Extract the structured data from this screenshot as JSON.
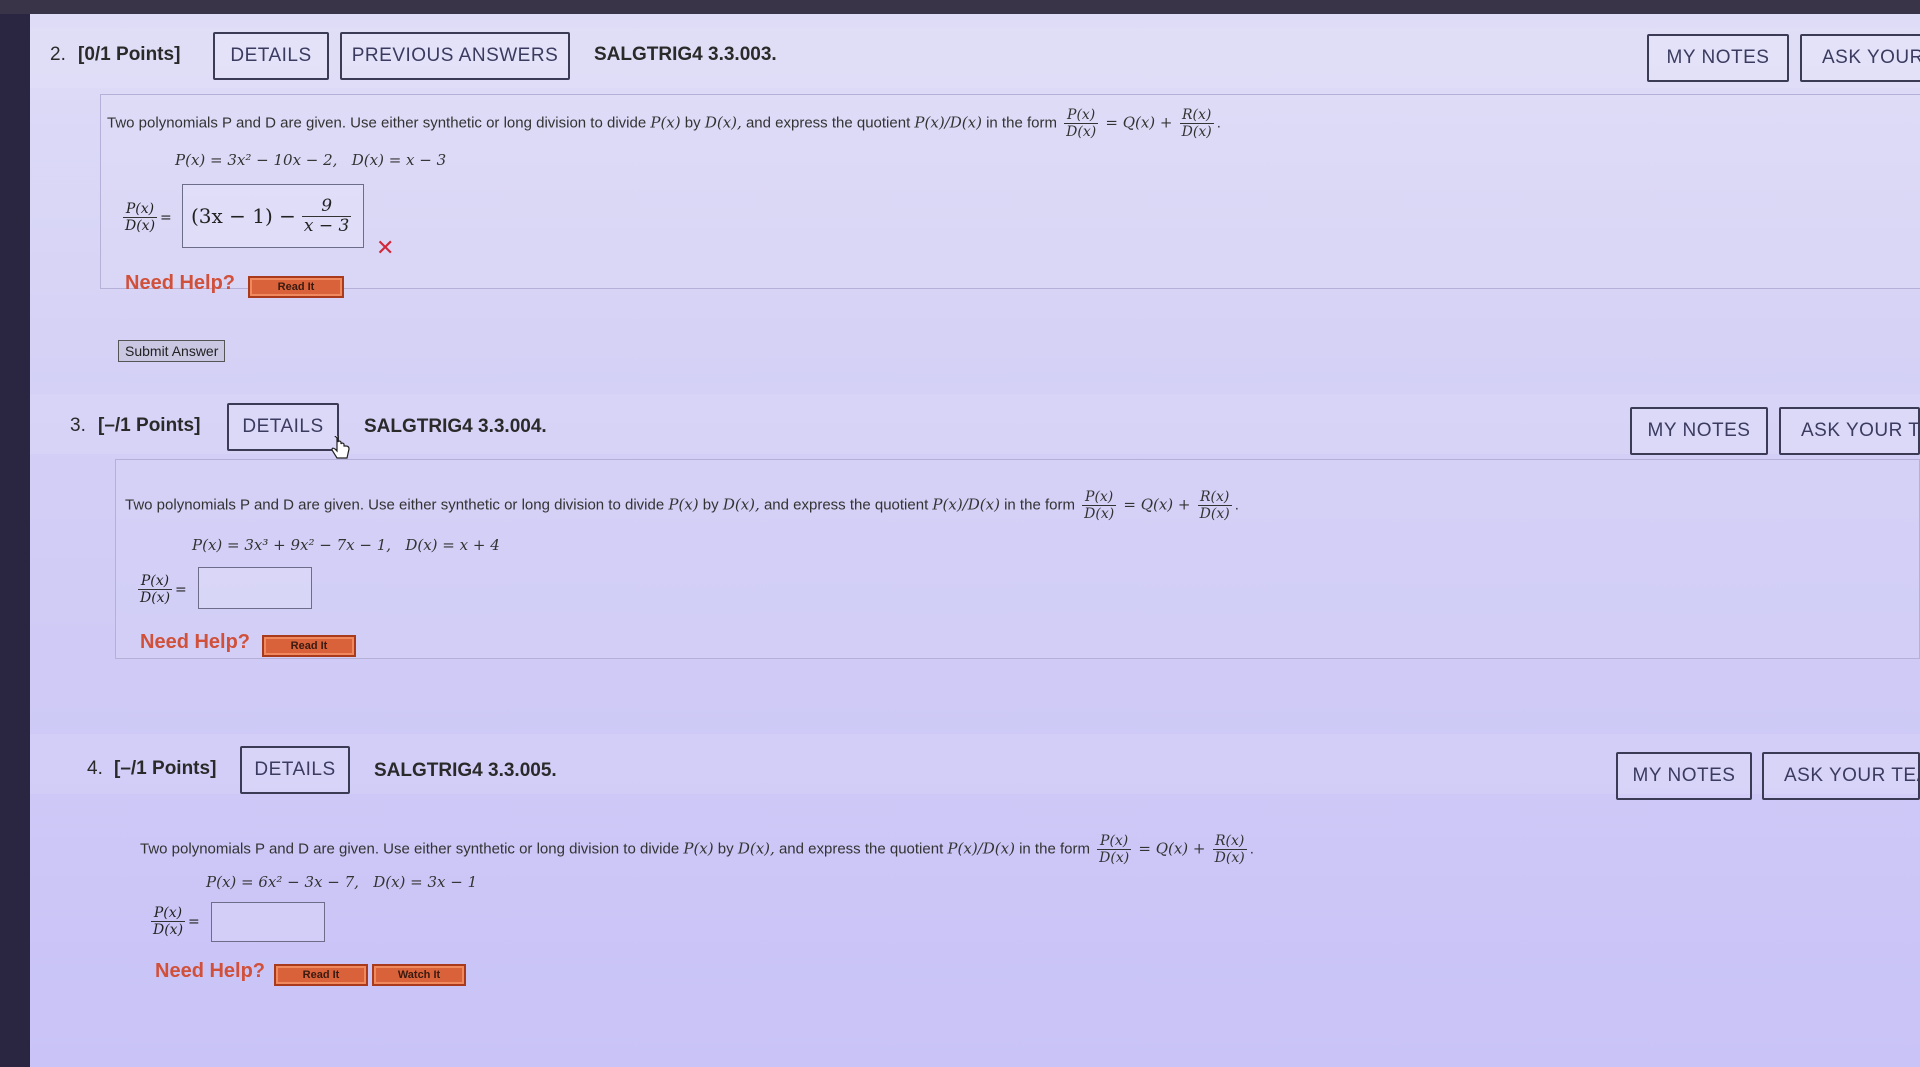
{
  "questions": [
    {
      "number": "2.",
      "points": "[0/1 Points]",
      "details_label": "DETAILS",
      "previous_answers_label": "PREVIOUS ANSWERS",
      "code": "SALGTRIG4 3.3.003.",
      "my_notes_label": "MY NOTES",
      "ask_label": "ASK YOUR",
      "prompt_text": "Two polynomials P and D are given. Use either synthetic or long division to divide",
      "given_P": "P(x) = 3x² − 10x − 2,",
      "given_D": "D(x) = x − 3",
      "answer_main": "(3x − 1) −",
      "answer_num": "9",
      "answer_den": "x − 3",
      "need_help": "Need Help?",
      "read_it": "Read It",
      "submit_label": "Submit Answer"
    },
    {
      "number": "3.",
      "points": "[–/1 Points]",
      "details_label": "DETAILS",
      "code": "SALGTRIG4 3.3.004.",
      "my_notes_label": "MY NOTES",
      "ask_label": "ASK YOUR TE",
      "prompt_text": "Two polynomials P and D are given. Use either synthetic or long division to divide",
      "given_P": "P(x) = 3x³ + 9x² − 7x − 1,",
      "given_D": "D(x) = x + 4",
      "need_help": "Need Help?",
      "read_it": "Read It"
    },
    {
      "number": "4.",
      "points": "[–/1 Points]",
      "details_label": "DETAILS",
      "code": "SALGTRIG4 3.3.005.",
      "my_notes_label": "MY NOTES",
      "ask_label": "ASK YOUR TEA",
      "prompt_text": "Two polynomials P and D are given. Use either synthetic or long division to divide",
      "given_P": "P(x) = 6x² − 3x − 7,",
      "given_D": "D(x) = 3x − 1",
      "need_help": "Need Help?",
      "read_it": "Read It",
      "watch_it": "Watch It"
    }
  ],
  "common": {
    "px": "P(x)",
    "by": "by",
    "dx": "D(x),",
    "express": "and express the quotient",
    "quot": "P(x)/D(x)",
    "in_form": "in the form",
    "frac_P": "P(x)",
    "frac_D": "D(x)",
    "frac_R": "R(x)",
    "eq_Q": "= Q(x) +",
    "eq": "="
  }
}
